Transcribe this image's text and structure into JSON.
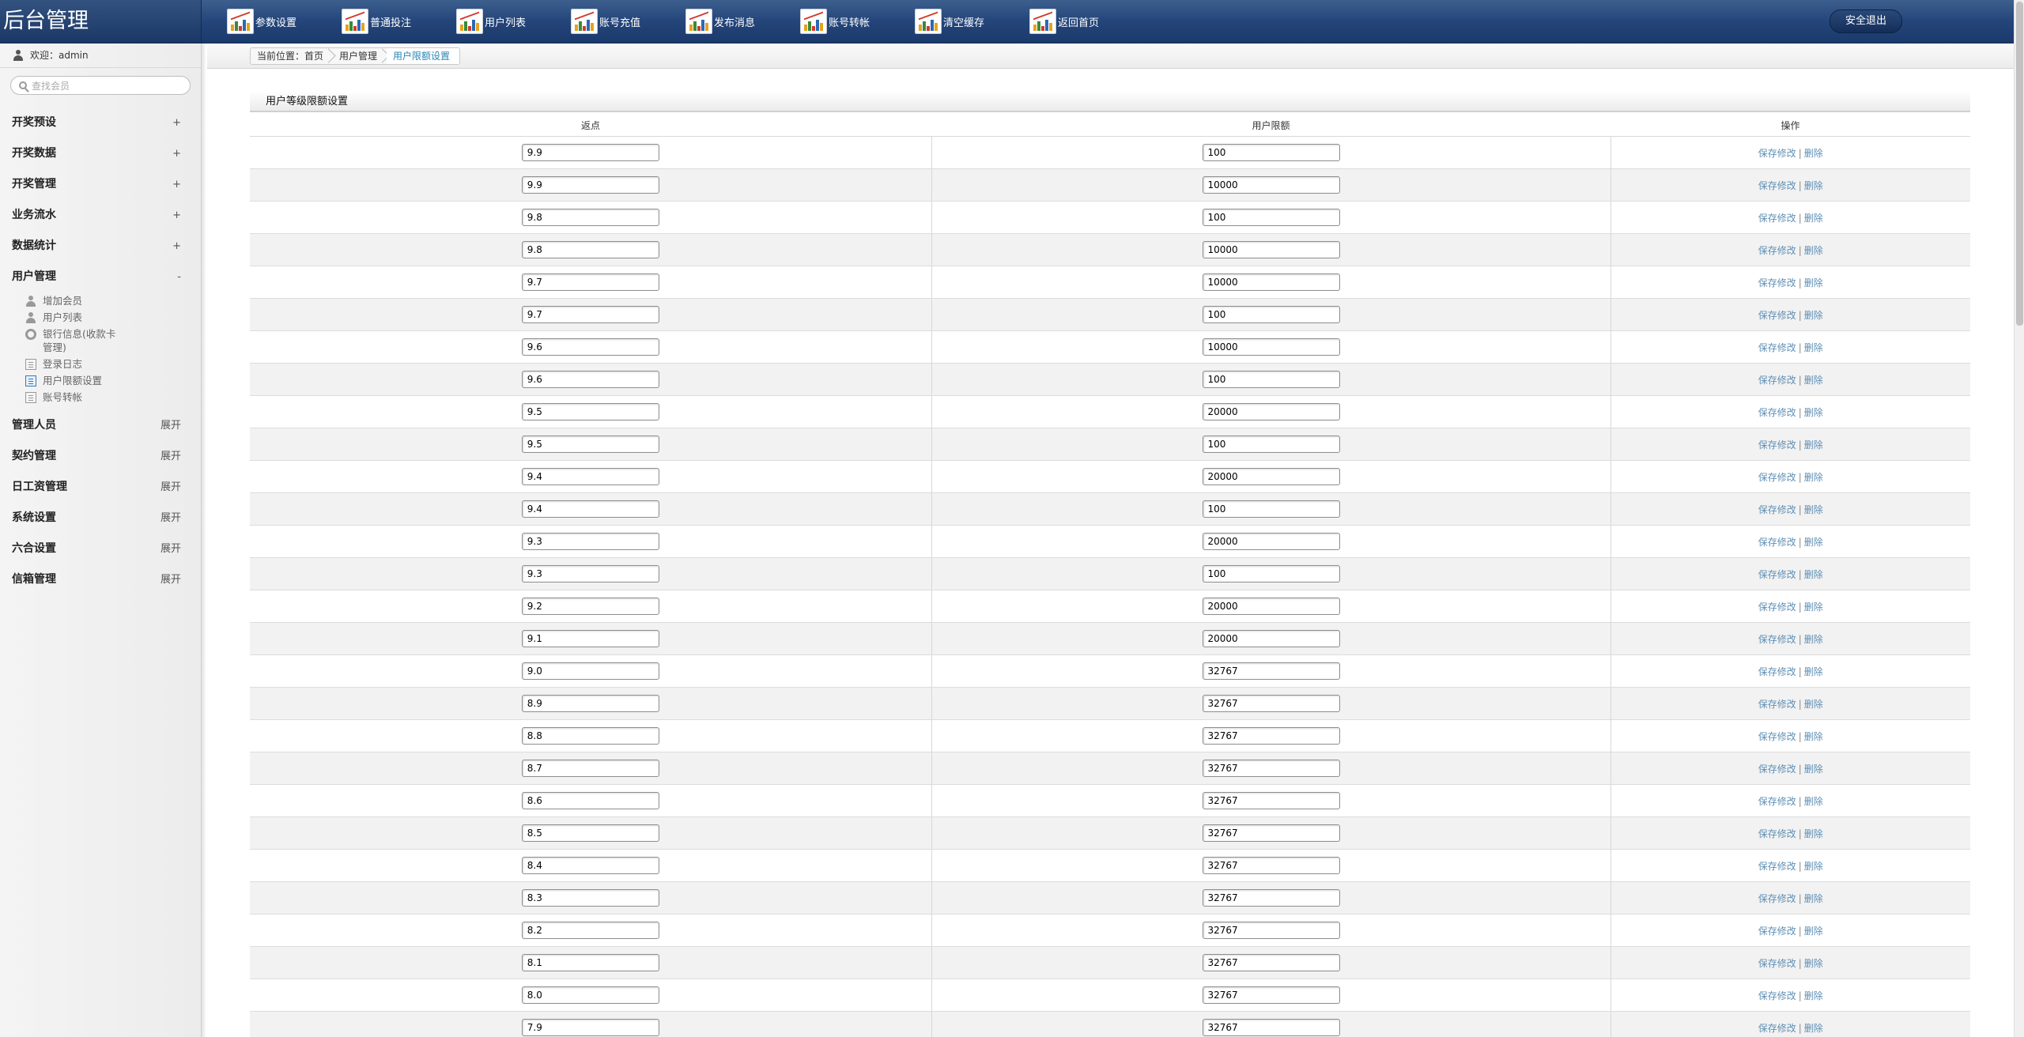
{
  "brand": "后台管理",
  "topnav": [
    {
      "label": "参数设置",
      "name": "nav-param-settings"
    },
    {
      "label": "普通投注",
      "name": "nav-normal-bet"
    },
    {
      "label": "用户列表",
      "name": "nav-user-list"
    },
    {
      "label": "账号充值",
      "name": "nav-account-recharge"
    },
    {
      "label": "发布消息",
      "name": "nav-publish-message"
    },
    {
      "label": "账号转帐",
      "name": "nav-account-transfer"
    },
    {
      "label": "清空缓存",
      "name": "nav-clear-cache"
    },
    {
      "label": "返回首页",
      "name": "nav-home"
    }
  ],
  "logout_label": "安全退出",
  "welcome": "欢迎：admin",
  "search_placeholder": "查找会员",
  "menu": {
    "groups_before": [
      {
        "label": "开奖预设",
        "toggle": "+"
      },
      {
        "label": "开奖数据",
        "toggle": "+"
      },
      {
        "label": "开奖管理",
        "toggle": "+"
      },
      {
        "label": "业务流水",
        "toggle": "+"
      },
      {
        "label": "数据统计",
        "toggle": "+"
      },
      {
        "label": "用户管理",
        "toggle": "-"
      }
    ],
    "sub_items": [
      {
        "label": "增加会员",
        "icon": "user-icon"
      },
      {
        "label": "用户列表",
        "icon": "user-icon"
      },
      {
        "label": "银行信息(收款卡管理)",
        "icon": "gear-icon"
      },
      {
        "label": "登录日志",
        "icon": "document-icon"
      },
      {
        "label": "用户限额设置",
        "icon": "document-icon",
        "active": true
      },
      {
        "label": "账号转帐",
        "icon": "document-icon"
      }
    ],
    "groups_after": [
      {
        "label": "管理人员",
        "toggle": "展开"
      },
      {
        "label": "契约管理",
        "toggle": "展开"
      },
      {
        "label": "日工资管理",
        "toggle": "展开"
      },
      {
        "label": "系统设置",
        "toggle": "展开"
      },
      {
        "label": "六合设置",
        "toggle": "展开"
      },
      {
        "label": "信箱管理",
        "toggle": "展开"
      }
    ]
  },
  "breadcrumb": [
    "当前位置：首页",
    "用户管理",
    "用户限额设置"
  ],
  "panel_title": "用户等级限额设置",
  "table": {
    "headers": [
      "返点",
      "用户限额",
      "操作"
    ],
    "save_label": "保存修改",
    "separator": "|",
    "delete_label": "删除",
    "rows": [
      {
        "rebate": "9.9",
        "limit": "100"
      },
      {
        "rebate": "9.9",
        "limit": "10000"
      },
      {
        "rebate": "9.8",
        "limit": "100"
      },
      {
        "rebate": "9.8",
        "limit": "10000"
      },
      {
        "rebate": "9.7",
        "limit": "10000"
      },
      {
        "rebate": "9.7",
        "limit": "100"
      },
      {
        "rebate": "9.6",
        "limit": "10000"
      },
      {
        "rebate": "9.6",
        "limit": "100"
      },
      {
        "rebate": "9.5",
        "limit": "20000"
      },
      {
        "rebate": "9.5",
        "limit": "100"
      },
      {
        "rebate": "9.4",
        "limit": "20000"
      },
      {
        "rebate": "9.4",
        "limit": "100"
      },
      {
        "rebate": "9.3",
        "limit": "20000"
      },
      {
        "rebate": "9.3",
        "limit": "100"
      },
      {
        "rebate": "9.2",
        "limit": "20000"
      },
      {
        "rebate": "9.1",
        "limit": "20000"
      },
      {
        "rebate": "9.0",
        "limit": "32767"
      },
      {
        "rebate": "8.9",
        "limit": "32767"
      },
      {
        "rebate": "8.8",
        "limit": "32767"
      },
      {
        "rebate": "8.7",
        "limit": "32767"
      },
      {
        "rebate": "8.6",
        "limit": "32767"
      },
      {
        "rebate": "8.5",
        "limit": "32767"
      },
      {
        "rebate": "8.4",
        "limit": "32767"
      },
      {
        "rebate": "8.3",
        "limit": "32767"
      },
      {
        "rebate": "8.2",
        "limit": "32767"
      },
      {
        "rebate": "8.1",
        "limit": "32767"
      },
      {
        "rebate": "8.0",
        "limit": "32767"
      },
      {
        "rebate": "7.9",
        "limit": "32767"
      }
    ]
  }
}
